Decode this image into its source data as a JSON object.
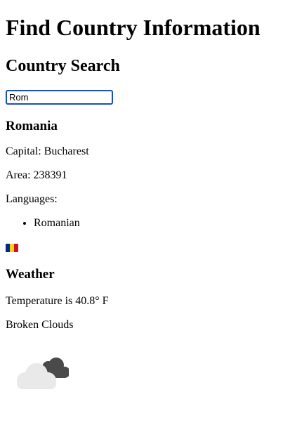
{
  "page": {
    "title": "Find Country Information",
    "section_title": "Country Search"
  },
  "search": {
    "value": "Rom",
    "placeholder": ""
  },
  "country": {
    "name": "Romania",
    "capital": "Capital: Bucharest",
    "area": "Area: 238391",
    "languages_label": "Languages:",
    "languages": [
      "Romanian"
    ],
    "flag_colors": [
      "#002B7F",
      "#FCD116",
      "#CE1126"
    ],
    "flag_icon": "flag-romania"
  },
  "weather": {
    "heading": "Weather",
    "temperature": "Temperature is 40.8° F",
    "description": "Broken Clouds",
    "icon": "broken-clouds-icon",
    "cloud_colors": {
      "front": "#e9e9e9",
      "back": "#4a4a4a"
    }
  }
}
